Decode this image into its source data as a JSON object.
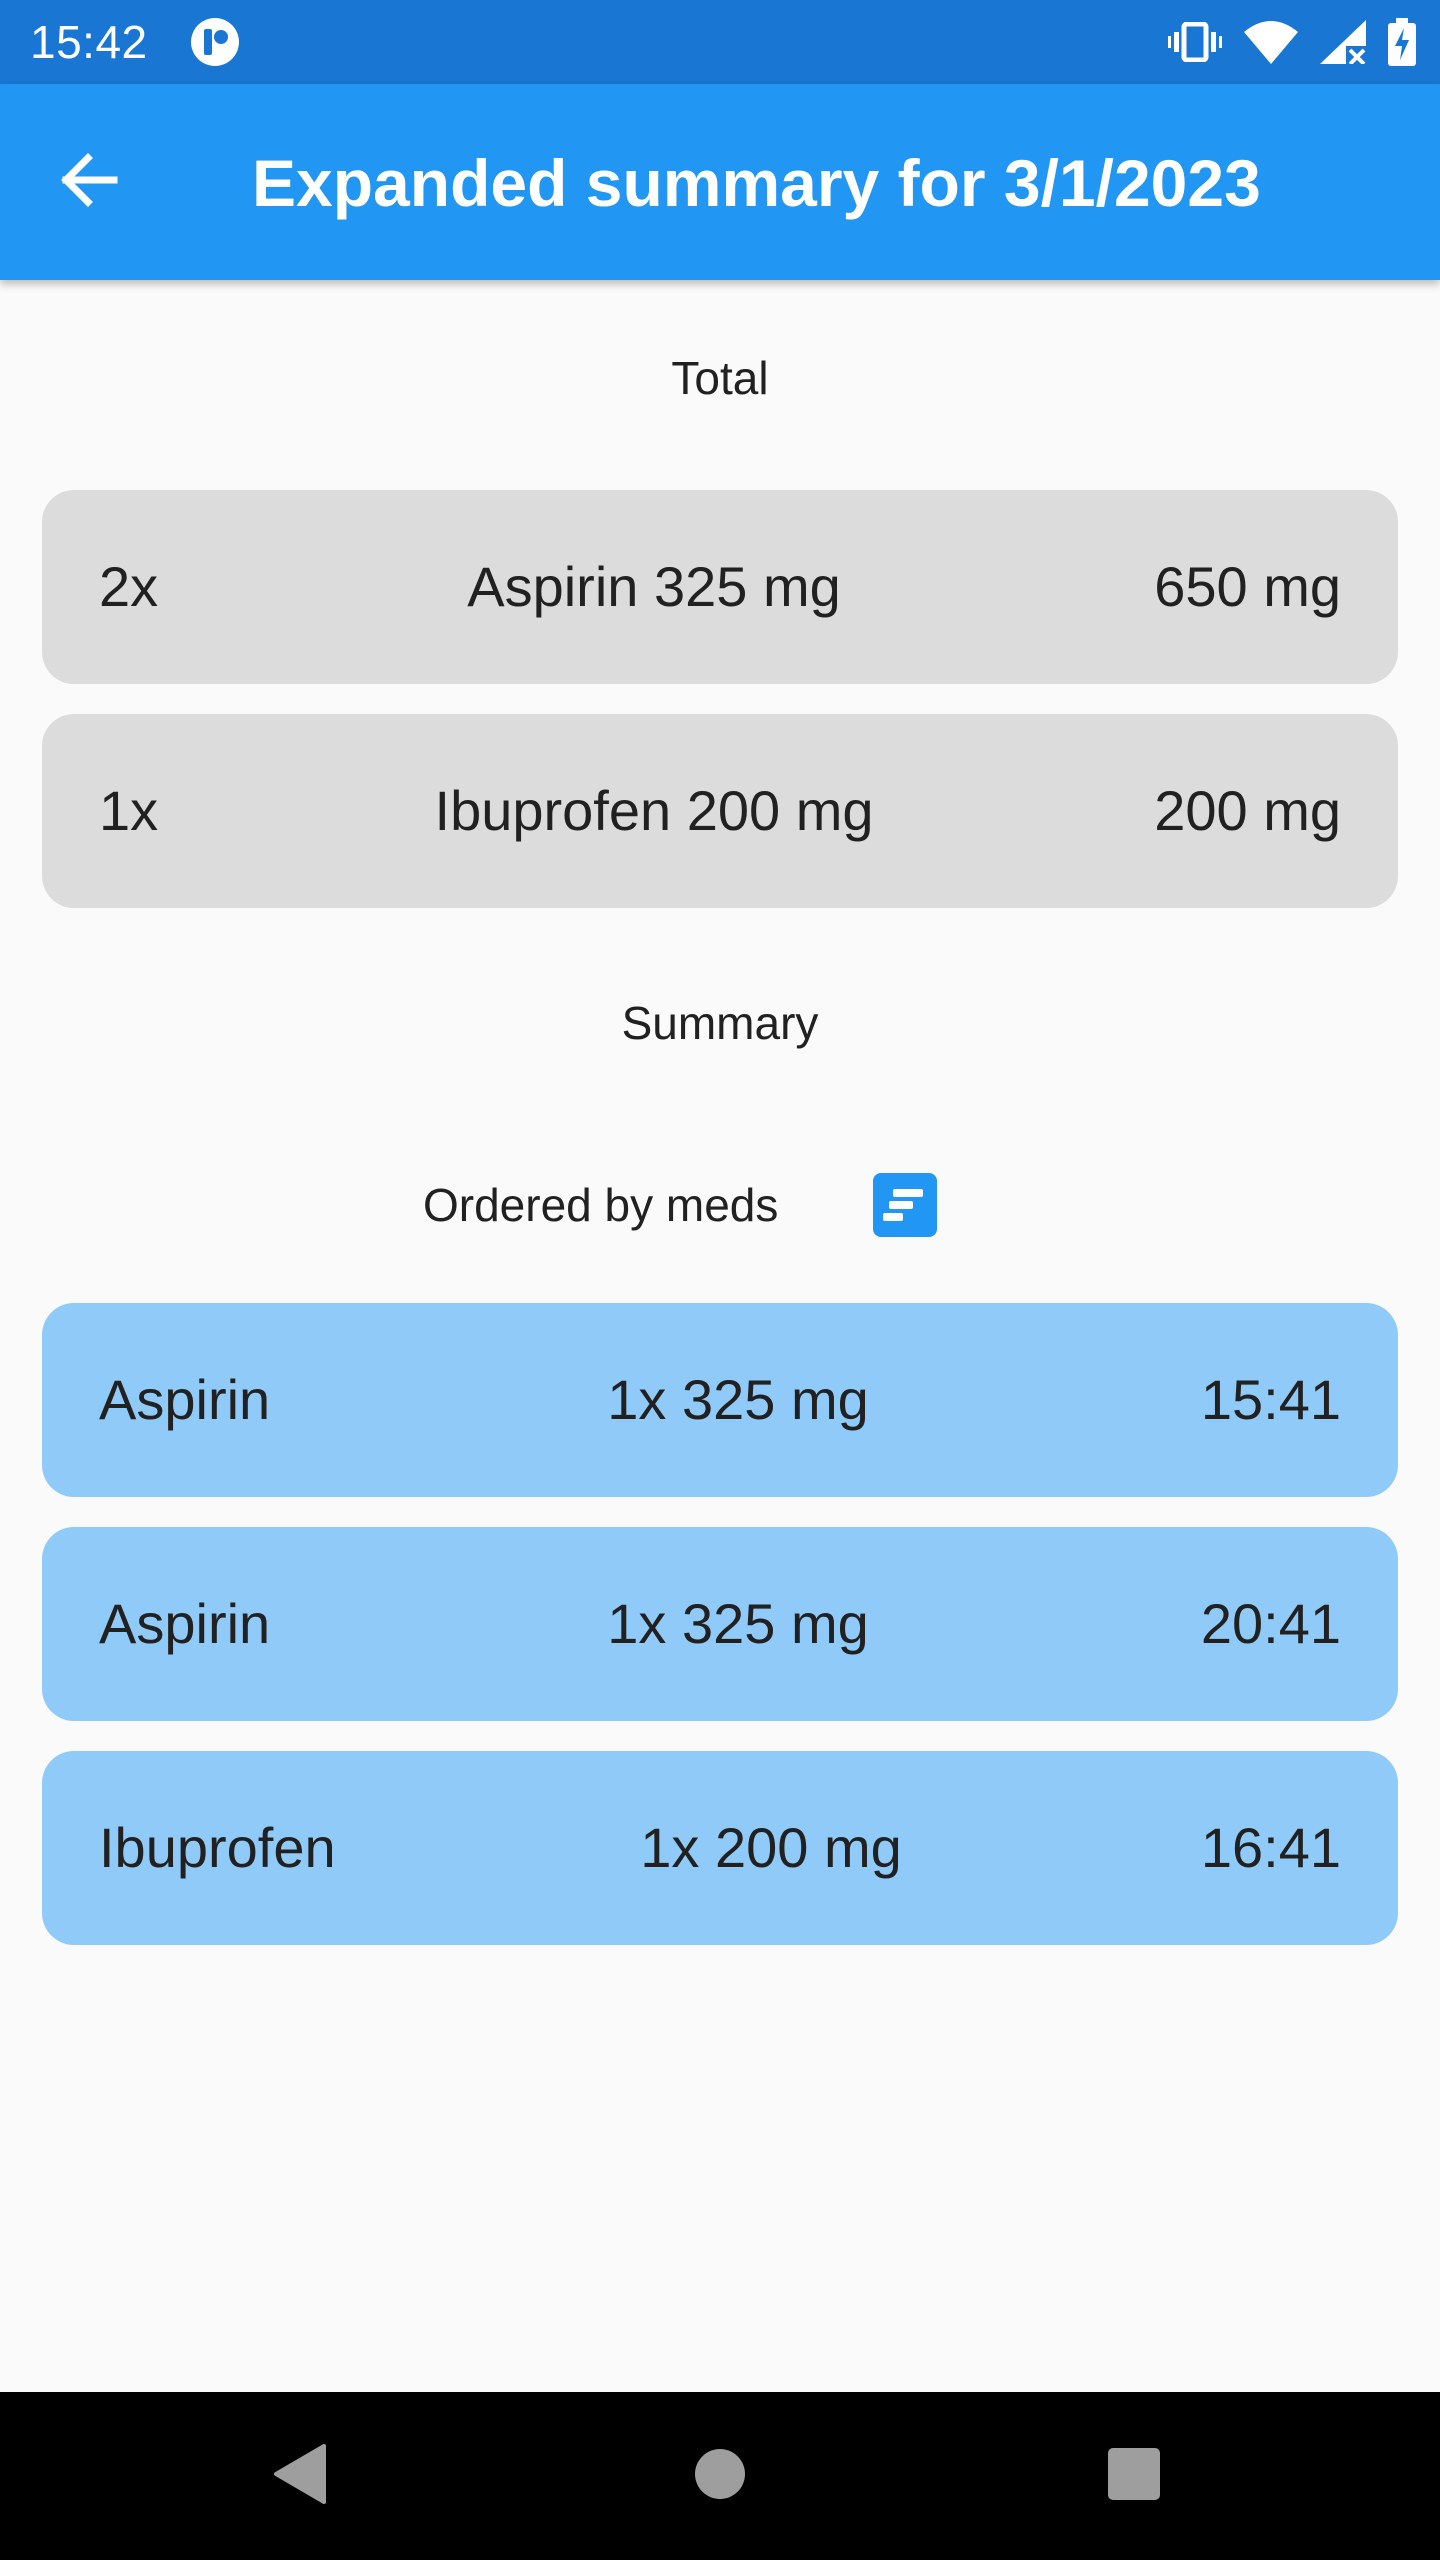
{
  "status_bar": {
    "time": "15:42",
    "icons": [
      "app-notification-icon",
      "vibrate-icon",
      "wifi-icon",
      "cellular-no-signal-icon",
      "battery-charging-icon"
    ]
  },
  "app_bar": {
    "back_icon": "arrow-back-icon",
    "title": "Expanded summary for 3/1/2023"
  },
  "total": {
    "heading": "Total",
    "items": [
      {
        "count": "2x",
        "name": "Aspirin 325 mg",
        "amount": "650 mg"
      },
      {
        "count": "1x",
        "name": "Ibuprofen 200 mg",
        "amount": "200 mg"
      }
    ]
  },
  "summary": {
    "heading": "Summary",
    "order_label": "Ordered by meds",
    "sort_icon": "sort-icon",
    "items": [
      {
        "med": "Aspirin",
        "dose": "1x 325 mg",
        "time": "15:41"
      },
      {
        "med": "Aspirin",
        "dose": "1x 325 mg",
        "time": "20:41"
      },
      {
        "med": "Ibuprofen",
        "dose": "1x 200 mg",
        "time": "16:41"
      }
    ]
  },
  "colors": {
    "status_bar": "#1976D2",
    "app_bar": "#2196F3",
    "background": "#FAFAFA",
    "total_card": "#DCDCDC",
    "summary_card": "#90CAF9",
    "nav_bar": "#000000",
    "nav_icons": "#9E9E9E"
  },
  "nav_bar": {
    "icons": [
      "back-triangle-icon",
      "home-circle-icon",
      "recents-square-icon"
    ]
  }
}
